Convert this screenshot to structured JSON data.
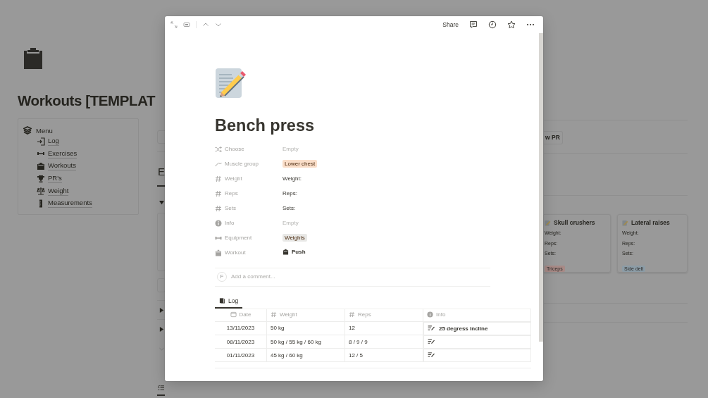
{
  "background_page": {
    "title": "Workouts [TEMPLAT",
    "menu": {
      "label": "Menu",
      "items": [
        {
          "label": "Log"
        },
        {
          "label": "Exercises"
        },
        {
          "label": "Workouts"
        },
        {
          "label": "PR's"
        },
        {
          "label": "Weight"
        },
        {
          "label": "Measurements"
        }
      ]
    },
    "section_headings": [
      "E"
    ],
    "button": "w PR",
    "cards": [
      {
        "title": "Skull crushers",
        "fields": [
          "Weight:",
          "Reps:",
          "Sets:"
        ],
        "tag": {
          "label": "Triceps",
          "color": "#a88a86"
        }
      },
      {
        "title": "Lateral raises",
        "fields": [
          "Weight:",
          "Reps:",
          "Sets:"
        ],
        "tag": {
          "label": "Side delt",
          "color": "#8c9ca6"
        }
      }
    ]
  },
  "modal": {
    "share": "Share",
    "title": "Bench press",
    "properties": [
      {
        "name": "Choose",
        "kind": "empty",
        "value": "Empty"
      },
      {
        "name": "Muscle group",
        "kind": "tag",
        "value": "Lower chest",
        "color": "#fadec9"
      },
      {
        "name": "Weight",
        "kind": "text",
        "value": "Weight:"
      },
      {
        "name": "Reps",
        "kind": "text",
        "value": "Reps:"
      },
      {
        "name": "Sets",
        "kind": "text",
        "value": "Sets:"
      },
      {
        "name": "Info",
        "kind": "empty",
        "value": "Empty"
      },
      {
        "name": "Equipment",
        "kind": "tag",
        "value": "Weights",
        "color": "#e9e9e7"
      },
      {
        "name": "Workout",
        "kind": "page",
        "value": "Push"
      }
    ],
    "comment": {
      "avatar": "F",
      "placeholder": "Add a comment..."
    },
    "log": {
      "tab": "Log",
      "columns": [
        "Date",
        "Weight",
        "Reps",
        "Info"
      ],
      "rows": [
        {
          "date": "13/11/2023",
          "weight": "50 kg",
          "reps": "12",
          "info": "25 degress incline"
        },
        {
          "date": "08/11/2023",
          "weight": "50 kg / 55 kg / 60 kg",
          "reps": "8 / 9 / 9"
        },
        {
          "date": "01/11/2023",
          "weight": "45 kg / 60 kg",
          "reps": "12 / 5"
        }
      ]
    }
  }
}
